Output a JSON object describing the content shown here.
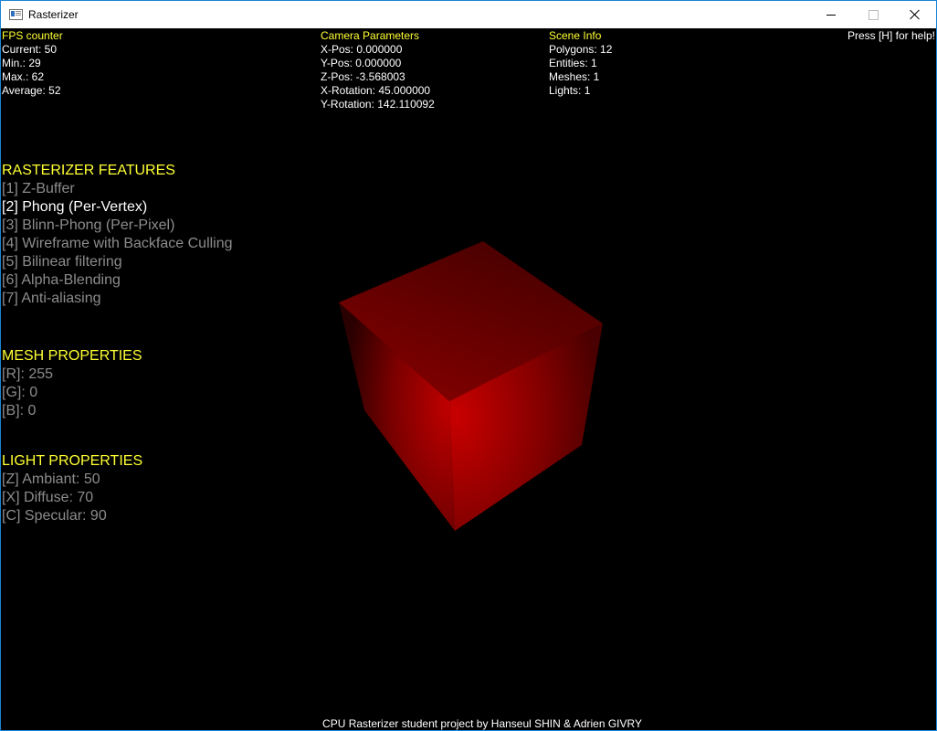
{
  "window": {
    "title": "Rasterizer"
  },
  "hud": {
    "fps": {
      "heading": "FPS counter",
      "lines": [
        "Current: 50",
        "Min.: 29",
        "Max.: 62",
        "Average: 52"
      ]
    },
    "camera": {
      "heading": "Camera Parameters",
      "lines": [
        "X-Pos: 0.000000",
        "Y-Pos: 0.000000",
        "Z-Pos: -3.568003",
        "X-Rotation: 45.000000",
        "Y-Rotation: 142.110092"
      ]
    },
    "scene": {
      "heading": "Scene Info",
      "lines": [
        "Polygons: 12",
        "Entities: 1",
        "Meshes: 1",
        "Lights: 1"
      ]
    },
    "help": "Press [H] for help!"
  },
  "features": {
    "heading": "RASTERIZER FEATURES",
    "items": [
      "[1] Z-Buffer",
      "[2] Phong (Per-Vertex)",
      "[3] Blinn-Phong (Per-Pixel)",
      "[4] Wireframe with Backface Culling",
      "[5] Bilinear filtering",
      "[6] Alpha-Blending",
      "[7] Anti-aliasing"
    ],
    "active_index": 1
  },
  "mesh": {
    "heading": "MESH PROPERTIES",
    "items": [
      "[R]: 255",
      "[G]: 0",
      "[B]: 0"
    ]
  },
  "light": {
    "heading": "LIGHT PROPERTIES",
    "items": [
      "[Z] Ambiant: 50",
      "[X] Diffuse: 70",
      "[C] Specular: 90"
    ]
  },
  "footer": "CPU Rasterizer student project by Hanseul SHIN & Adrien GIVRY",
  "colors": {
    "heading": "#ffff33",
    "inactive": "#8c8c8c",
    "active": "#ffffff",
    "cube": "#ff0000"
  }
}
